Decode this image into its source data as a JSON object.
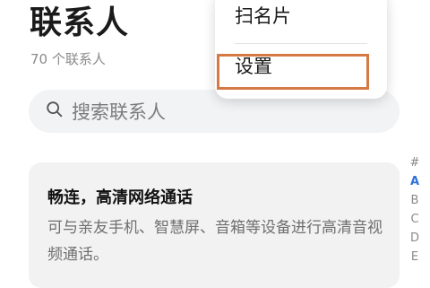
{
  "header": {
    "title": "联系人",
    "count_text": "70 个联系人"
  },
  "search": {
    "icon": "search-icon",
    "placeholder": "搜索联系人"
  },
  "promo_card": {
    "title": "畅连，高清网络通话",
    "description": "可与亲友手机、智慧屏、音箱等设备进行高清音视频通话。"
  },
  "alphabet_index": [
    "#",
    "A",
    "B",
    "C",
    "D",
    "E"
  ],
  "alphabet_active": "A",
  "overflow_menu": {
    "items": [
      {
        "label": "扫名片"
      },
      {
        "label": "设置",
        "highlighted": true
      }
    ]
  },
  "colors": {
    "highlight_border": "#d67a45",
    "index_active": "#2f73d9",
    "card_background": "#f2f2f2",
    "search_background": "#f1f3f5"
  }
}
